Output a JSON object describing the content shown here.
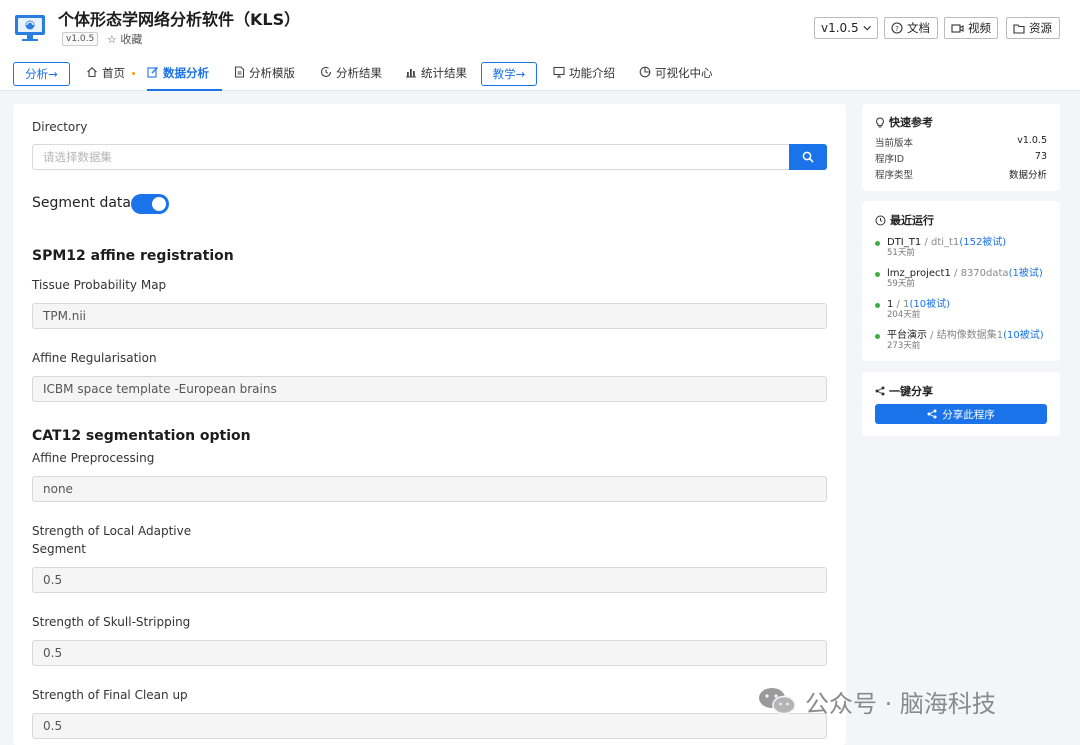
{
  "header": {
    "title": "个体形态学网络分析软件（KLS）",
    "version_badge": "v1.0.5",
    "favorite_label": "☆ 收藏",
    "version_select": "v1.0.5",
    "docs_label": "文档",
    "video_label": "视频",
    "resources_label": "资源"
  },
  "nav": {
    "analysis_pill": "分析→",
    "tabs": [
      {
        "label": "首页",
        "icon": "home-icon"
      },
      {
        "label": "数据分析",
        "icon": "edit-icon",
        "active": true
      },
      {
        "label": "分析模版",
        "icon": "document-icon"
      },
      {
        "label": "分析结果",
        "icon": "history-icon"
      },
      {
        "label": "统计结果",
        "icon": "bar-chart-icon"
      }
    ],
    "teaching_pill": "教学→",
    "tabs2": [
      {
        "label": "功能介绍",
        "icon": "monitor-icon"
      },
      {
        "label": "可视化中心",
        "icon": "pie-chart-icon"
      }
    ]
  },
  "form": {
    "directory_label": "Directory",
    "directory_placeholder": "请选择数据集",
    "segment_label": "Segment data",
    "segment_on": true,
    "spm_section": "SPM12 affine registration",
    "tpm_label": "Tissue Probability Map",
    "tpm_value": "TPM.nii",
    "affine_reg_label": "Affine Regularisation",
    "affine_reg_value": "ICBM space template -European brains",
    "cat_section": "CAT12 segmentation option",
    "affine_pre_label": "Affine Preprocessing",
    "affine_pre_value": "none",
    "las_label_1": "Strength of Local Adaptive",
    "las_label_2": "Segment",
    "las_value": "0.5",
    "skull_label": "Strength of Skull-Stripping",
    "skull_value": "0.5",
    "clean_label": "Strength of Final Clean up",
    "clean_value": "0.5"
  },
  "quick_ref": {
    "title": "快速参考",
    "rows": [
      {
        "key": "当前版本",
        "value": "v1.0.5"
      },
      {
        "key": "程序ID",
        "value": "73"
      },
      {
        "key": "程序类型",
        "value": "数据分析"
      }
    ]
  },
  "recent_runs": {
    "title": "最近运行",
    "items": [
      {
        "name": "DTI_T1",
        "sep": " / ",
        "dataset": "dti_t1",
        "subjects": "(152被试)",
        "ago": "51天前"
      },
      {
        "name": "lmz_project1",
        "sep": " / ",
        "dataset": "8370data",
        "subjects": "(1被试)",
        "ago": "59天前"
      },
      {
        "name": "1",
        "sep": " / ",
        "dataset": "1",
        "subjects": "(10被试)",
        "ago": "204天前"
      },
      {
        "name": "平台演示",
        "sep": " / ",
        "dataset": "结构像数据集1",
        "subjects": "(10被试)",
        "ago": "273天前"
      }
    ]
  },
  "share": {
    "title": "一键分享",
    "button": "分享此程序"
  },
  "watermark": "公众号 · 脑海科技",
  "colors": {
    "accent": "#1a73e8",
    "run_status": "#3cb043"
  }
}
